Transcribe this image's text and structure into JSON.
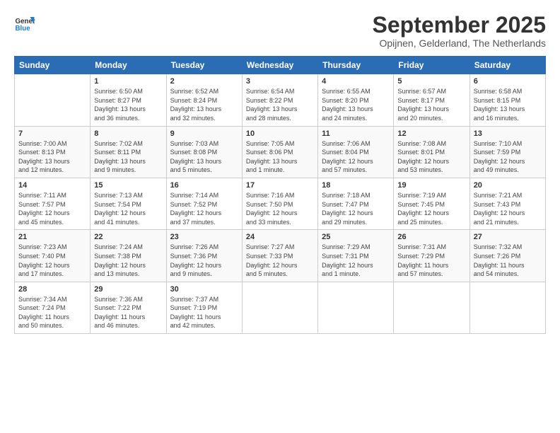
{
  "logo": {
    "line1": "General",
    "line2": "Blue"
  },
  "title": "September 2025",
  "location": "Opijnen, Gelderland, The Netherlands",
  "weekdays": [
    "Sunday",
    "Monday",
    "Tuesday",
    "Wednesday",
    "Thursday",
    "Friday",
    "Saturday"
  ],
  "weeks": [
    [
      {
        "day": "",
        "info": ""
      },
      {
        "day": "1",
        "info": "Sunrise: 6:50 AM\nSunset: 8:27 PM\nDaylight: 13 hours\nand 36 minutes."
      },
      {
        "day": "2",
        "info": "Sunrise: 6:52 AM\nSunset: 8:24 PM\nDaylight: 13 hours\nand 32 minutes."
      },
      {
        "day": "3",
        "info": "Sunrise: 6:54 AM\nSunset: 8:22 PM\nDaylight: 13 hours\nand 28 minutes."
      },
      {
        "day": "4",
        "info": "Sunrise: 6:55 AM\nSunset: 8:20 PM\nDaylight: 13 hours\nand 24 minutes."
      },
      {
        "day": "5",
        "info": "Sunrise: 6:57 AM\nSunset: 8:17 PM\nDaylight: 13 hours\nand 20 minutes."
      },
      {
        "day": "6",
        "info": "Sunrise: 6:58 AM\nSunset: 8:15 PM\nDaylight: 13 hours\nand 16 minutes."
      }
    ],
    [
      {
        "day": "7",
        "info": "Sunrise: 7:00 AM\nSunset: 8:13 PM\nDaylight: 13 hours\nand 12 minutes."
      },
      {
        "day": "8",
        "info": "Sunrise: 7:02 AM\nSunset: 8:11 PM\nDaylight: 13 hours\nand 9 minutes."
      },
      {
        "day": "9",
        "info": "Sunrise: 7:03 AM\nSunset: 8:08 PM\nDaylight: 13 hours\nand 5 minutes."
      },
      {
        "day": "10",
        "info": "Sunrise: 7:05 AM\nSunset: 8:06 PM\nDaylight: 13 hours\nand 1 minute."
      },
      {
        "day": "11",
        "info": "Sunrise: 7:06 AM\nSunset: 8:04 PM\nDaylight: 12 hours\nand 57 minutes."
      },
      {
        "day": "12",
        "info": "Sunrise: 7:08 AM\nSunset: 8:01 PM\nDaylight: 12 hours\nand 53 minutes."
      },
      {
        "day": "13",
        "info": "Sunrise: 7:10 AM\nSunset: 7:59 PM\nDaylight: 12 hours\nand 49 minutes."
      }
    ],
    [
      {
        "day": "14",
        "info": "Sunrise: 7:11 AM\nSunset: 7:57 PM\nDaylight: 12 hours\nand 45 minutes."
      },
      {
        "day": "15",
        "info": "Sunrise: 7:13 AM\nSunset: 7:54 PM\nDaylight: 12 hours\nand 41 minutes."
      },
      {
        "day": "16",
        "info": "Sunrise: 7:14 AM\nSunset: 7:52 PM\nDaylight: 12 hours\nand 37 minutes."
      },
      {
        "day": "17",
        "info": "Sunrise: 7:16 AM\nSunset: 7:50 PM\nDaylight: 12 hours\nand 33 minutes."
      },
      {
        "day": "18",
        "info": "Sunrise: 7:18 AM\nSunset: 7:47 PM\nDaylight: 12 hours\nand 29 minutes."
      },
      {
        "day": "19",
        "info": "Sunrise: 7:19 AM\nSunset: 7:45 PM\nDaylight: 12 hours\nand 25 minutes."
      },
      {
        "day": "20",
        "info": "Sunrise: 7:21 AM\nSunset: 7:43 PM\nDaylight: 12 hours\nand 21 minutes."
      }
    ],
    [
      {
        "day": "21",
        "info": "Sunrise: 7:23 AM\nSunset: 7:40 PM\nDaylight: 12 hours\nand 17 minutes."
      },
      {
        "day": "22",
        "info": "Sunrise: 7:24 AM\nSunset: 7:38 PM\nDaylight: 12 hours\nand 13 minutes."
      },
      {
        "day": "23",
        "info": "Sunrise: 7:26 AM\nSunset: 7:36 PM\nDaylight: 12 hours\nand 9 minutes."
      },
      {
        "day": "24",
        "info": "Sunrise: 7:27 AM\nSunset: 7:33 PM\nDaylight: 12 hours\nand 5 minutes."
      },
      {
        "day": "25",
        "info": "Sunrise: 7:29 AM\nSunset: 7:31 PM\nDaylight: 12 hours\nand 1 minute."
      },
      {
        "day": "26",
        "info": "Sunrise: 7:31 AM\nSunset: 7:29 PM\nDaylight: 11 hours\nand 57 minutes."
      },
      {
        "day": "27",
        "info": "Sunrise: 7:32 AM\nSunset: 7:26 PM\nDaylight: 11 hours\nand 54 minutes."
      }
    ],
    [
      {
        "day": "28",
        "info": "Sunrise: 7:34 AM\nSunset: 7:24 PM\nDaylight: 11 hours\nand 50 minutes."
      },
      {
        "day": "29",
        "info": "Sunrise: 7:36 AM\nSunset: 7:22 PM\nDaylight: 11 hours\nand 46 minutes."
      },
      {
        "day": "30",
        "info": "Sunrise: 7:37 AM\nSunset: 7:19 PM\nDaylight: 11 hours\nand 42 minutes."
      },
      {
        "day": "",
        "info": ""
      },
      {
        "day": "",
        "info": ""
      },
      {
        "day": "",
        "info": ""
      },
      {
        "day": "",
        "info": ""
      }
    ]
  ]
}
